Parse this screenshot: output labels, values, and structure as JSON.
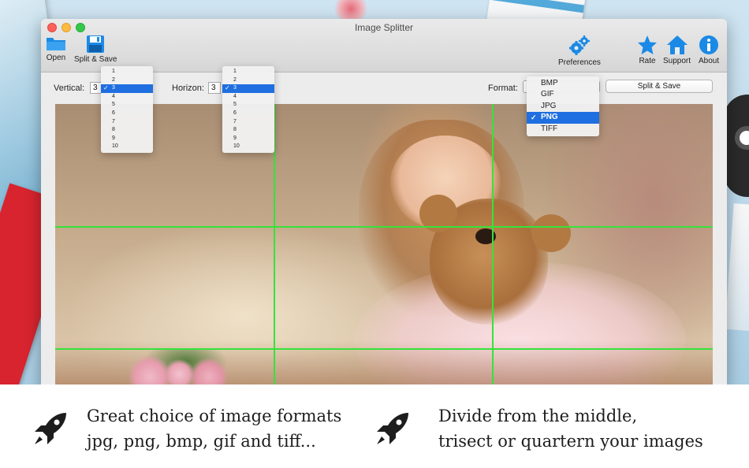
{
  "window": {
    "title": "Image Splitter"
  },
  "toolbar": {
    "open_label": "Open",
    "split_save_label": "Split & Save",
    "preferences_label": "Preferences",
    "rate_label": "Rate",
    "support_label": "Support",
    "about_label": "About"
  },
  "options": {
    "vertical_label": "Vertical:",
    "vertical_value": "3",
    "horizon_label": "Horizon:",
    "horizon_value": "3",
    "format_label": "Format:",
    "split_save_button": "Split & Save"
  },
  "vertical_menu": {
    "items": [
      "1",
      "2",
      "3",
      "4",
      "5",
      "6",
      "7",
      "8",
      "9",
      "10"
    ],
    "selected": "3"
  },
  "horizon_menu": {
    "items": [
      "1",
      "2",
      "3",
      "4",
      "5",
      "6",
      "7",
      "8",
      "9",
      "10"
    ],
    "selected": "3"
  },
  "format_menu": {
    "items": [
      "BMP",
      "GIF",
      "JPG",
      "PNG",
      "TIFF"
    ],
    "selected": "PNG"
  },
  "grid": {
    "color": "#35e33a",
    "vertical_divisions": 3,
    "horizontal_divisions": 3
  },
  "promo": {
    "feature1": {
      "line1": "Great choice of image formats",
      "line2": "jpg, png, bmp, gif and tiff..."
    },
    "feature2": {
      "line1": "Divide from the middle,",
      "line2": "trisect or quartern your images"
    }
  },
  "icons": {
    "open": "folder-icon",
    "split_save": "floppy-disk-icon",
    "preferences": "gears-icon",
    "rate": "star-icon",
    "support": "home-icon",
    "about": "info-icon",
    "feature": "rocket-icon"
  },
  "colors": {
    "accent": "#1f6fe0",
    "icon_blue": "#1b8ae6"
  }
}
